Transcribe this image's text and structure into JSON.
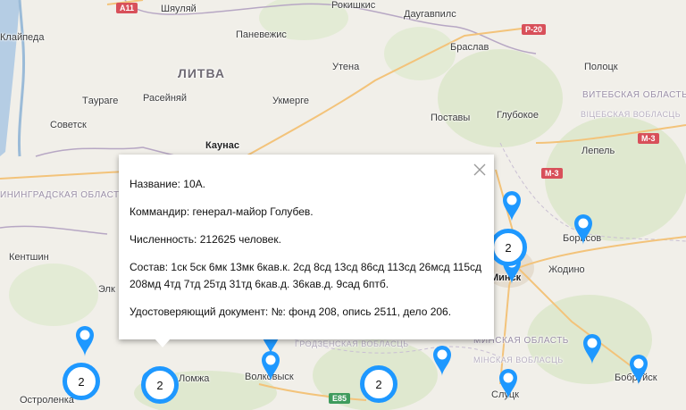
{
  "map": {
    "labels": {
      "country": "ЛИТВА",
      "cities": [
        "Шяуляй",
        "Рокишкис",
        "Даугавпилс",
        "Клайпеда",
        "Паневежис",
        "Браслав",
        "Утена",
        "Тaураге",
        "Расейняй",
        "Укмерге",
        "Поставы",
        "Глубокое",
        "Полоцк",
        "Советск",
        "Каунас",
        "Лепель",
        "Кентшин",
        "Борисов",
        "Жодино",
        "Минск",
        "Элк",
        "Волковыск",
        "Слуцк",
        "Бобруйск",
        "Остроленка",
        "Ломжа"
      ],
      "regions": {
        "vitebsk": "ВИТЕБСКАЯ ОБЛАСТЬ",
        "vitebsk_by": "ВІЦЕБСКАЯ ВОБЛАСЦЬ",
        "kaliningrad": "ИНИНГРАДСКАЯ ОБЛАСТЬ",
        "minsk": "МИНСКАЯ ОБЛАСТЬ",
        "minsk_by": "МІНСКАЯ ВОБЛАСЦЬ",
        "grodno_by": "ГРОДЗЕНСКАЯ ВОБЛАСЦЬ"
      },
      "shields": {
        "a11": "A11",
        "p20": "P-20",
        "m3a": "M-3",
        "m3b": "M-3",
        "e85": "E85"
      }
    },
    "clusters": [
      {
        "count": "2"
      },
      {
        "count": "2"
      },
      {
        "count": "2"
      },
      {
        "count": "2"
      }
    ],
    "colors": {
      "marker": "#1e98ff",
      "popup_bg": "#ffffff"
    }
  },
  "popup": {
    "close_icon": "close-icon",
    "name": "Название: 10А.",
    "commander": "Коммандир: генерал-майор Голубев.",
    "strength": "Численность: 212625 человек.",
    "composition": "Состав: 1ск 5ск 6мк 13мк 6кав.к. 2сд 8сд 13сд 86сд 113сд 26мсд 115сд 208мд 4тд 7тд 25тд 31тд 6кав.д. 36кав.д. 9сад 6птб.",
    "document": "Удостоверяющий документ: №: фонд 208, опись 2511, дело 206."
  }
}
